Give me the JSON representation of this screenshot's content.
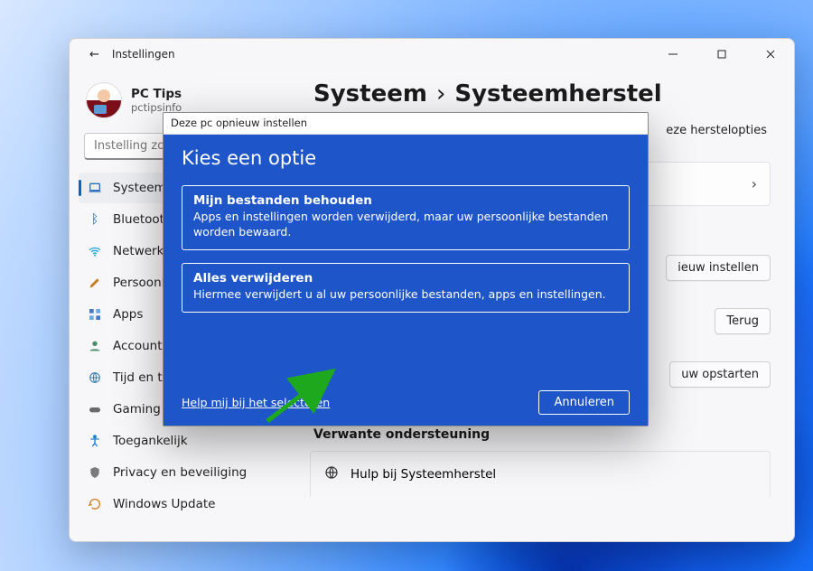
{
  "titlebar": {
    "back_label": "←",
    "title": "Instellingen"
  },
  "profile": {
    "name": "PC Tips",
    "sub": "pctipsinfo"
  },
  "search": {
    "placeholder": "Instelling zoeken"
  },
  "sidebar": {
    "items": [
      {
        "label": "Systeem",
        "icon": "laptop",
        "active": true
      },
      {
        "label": "Bluetooth en",
        "icon": "bluetooth"
      },
      {
        "label": "Netwerk en i",
        "icon": "wifi"
      },
      {
        "label": "Persoonlijke",
        "icon": "brush"
      },
      {
        "label": "Apps",
        "icon": "apps"
      },
      {
        "label": "Accounts",
        "icon": "person"
      },
      {
        "label": "Tijd en taal",
        "icon": "globe"
      },
      {
        "label": "Gaming",
        "icon": "gamepad"
      },
      {
        "label": "Toegankelijk",
        "icon": "accessibility"
      },
      {
        "label": "Privacy en beveiliging",
        "icon": "shield"
      },
      {
        "label": "Windows Update",
        "icon": "update"
      }
    ]
  },
  "content": {
    "crumb_a": "Systeem",
    "crumb_sep": "›",
    "crumb_b": "Systeemherstel",
    "hint": "eze herstelopties",
    "card1": {
      "label": "",
      "show_chevron": true
    },
    "btn1": "ieuw instellen",
    "btn2": "Terug",
    "btn3": "uw opstarten",
    "section": "Verwante ondersteuning",
    "help": "Hulp bij Systeemherstel"
  },
  "modal": {
    "title": "Deze pc opnieuw instellen",
    "heading": "Kies een optie",
    "opt1": {
      "title": "Mijn bestanden behouden",
      "desc": "Apps en instellingen worden verwijderd, maar uw persoonlijke bestanden worden bewaard."
    },
    "opt2": {
      "title": "Alles verwijderen",
      "desc": "Hiermee verwijdert u al uw persoonlijke bestanden, apps en instellingen."
    },
    "help_link": "Help mij bij het selecteren",
    "cancel": "Annuleren"
  }
}
